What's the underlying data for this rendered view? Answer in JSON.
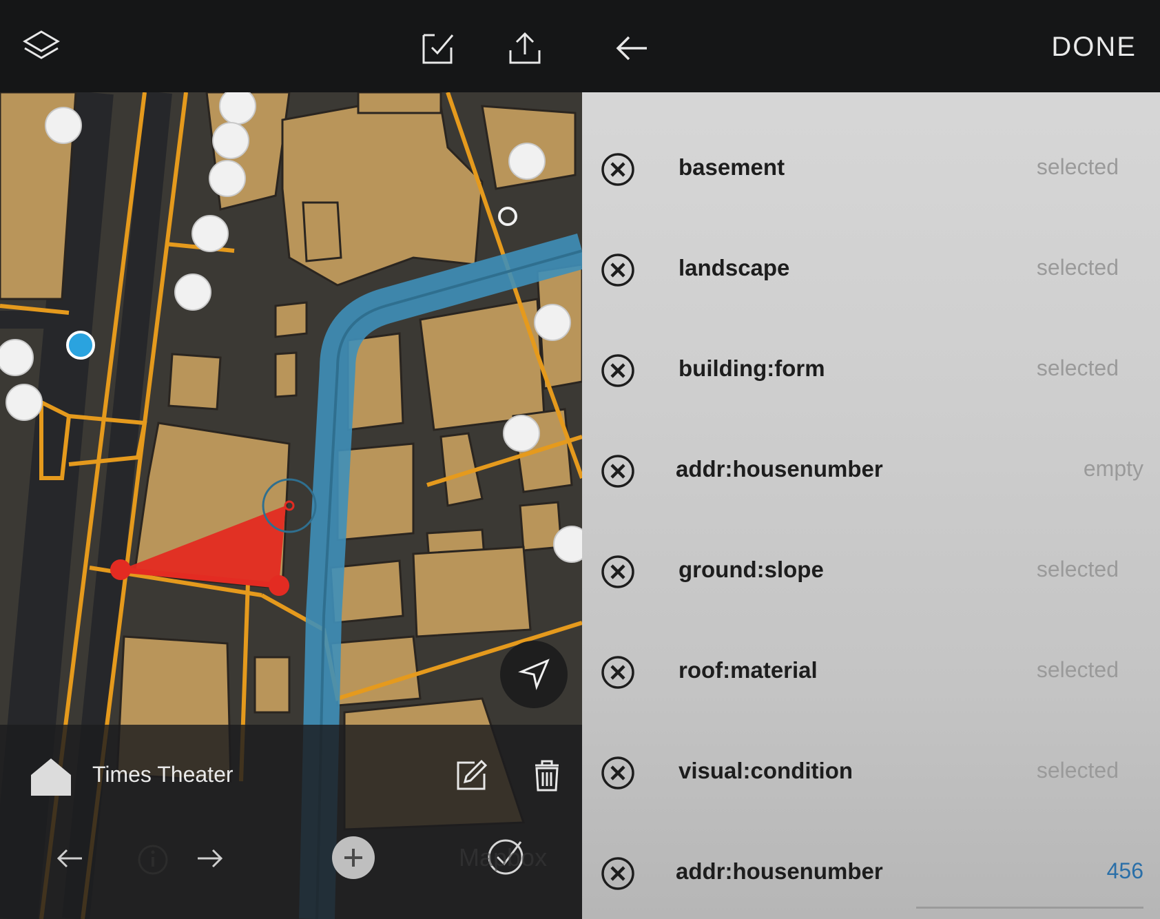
{
  "map_editor": {
    "toolbar": {
      "layers_icon": "layers-icon",
      "validate_icon": "checklist-icon",
      "upload_icon": "upload-icon"
    },
    "selected_feature": {
      "icon": "house-icon",
      "name": "Times Theater",
      "edit_icon": "pencil-icon",
      "delete_icon": "trash-icon"
    },
    "bottom_nav": {
      "prev_icon": "arrow-left-icon",
      "info_icon": "info-icon",
      "next_icon": "arrow-right-icon",
      "add_icon": "plus-icon",
      "confirm_icon": "check-circle-icon"
    },
    "watermark": "Mapbox",
    "locate_icon": "navigation-arrow-icon"
  },
  "tag_editor": {
    "back_icon": "arrow-left-icon",
    "done_label": "DONE",
    "tags": [
      {
        "key": "basement",
        "value": "selected"
      },
      {
        "key": "landscape",
        "value": "selected"
      },
      {
        "key": "building:form",
        "value": "selected"
      },
      {
        "key": "addr:housenumber",
        "value": "empty"
      },
      {
        "key": "ground:slope",
        "value": "selected"
      },
      {
        "key": "roof:material",
        "value": "selected"
      },
      {
        "key": "visual:condition",
        "value": "selected"
      },
      {
        "key": "addr:housenumber",
        "value": "456"
      }
    ]
  },
  "colors": {
    "building": "#b9955a",
    "road_outline": "#e59a1d",
    "waterway": "#3f8fb8",
    "selection": "#e32b22",
    "user_location": "#2aa3df"
  }
}
